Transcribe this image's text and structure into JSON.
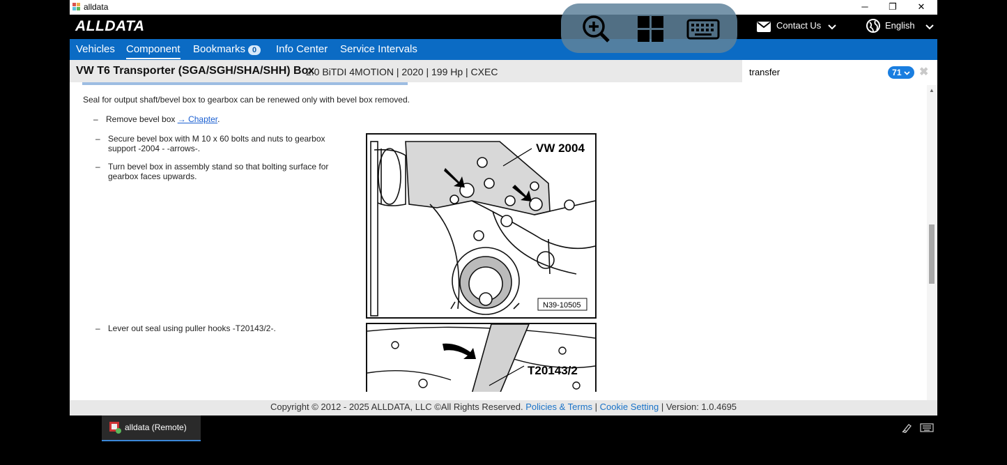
{
  "window": {
    "title": "alldata",
    "controls": [
      "─",
      "❐",
      "✕"
    ]
  },
  "header": {
    "logo": "ALLDATA",
    "contact_label": "Contact Us",
    "language_label": "English"
  },
  "nav": {
    "items": [
      {
        "label": "Vehicles"
      },
      {
        "label": "Component"
      },
      {
        "label": "Bookmarks"
      },
      {
        "label": "Info Center"
      },
      {
        "label": "Service Intervals"
      }
    ],
    "bookmarks_count": "0"
  },
  "vehicle": {
    "name": "VW T6 Transporter (SGA/SGH/SHA/SHH) Box",
    "specs": "2.0 BiTDI 4MOTION | 2020 | 199 Hp | CXEC"
  },
  "search": {
    "query": "transfer",
    "result_count": "71"
  },
  "content": {
    "intro": "Seal for output shaft/bevel box to gearbox can be renewed only with bevel box removed.",
    "steps": [
      {
        "text": "Remove bevel box ",
        "link": "→ Chapter",
        "suffix": "."
      },
      {
        "text": "Secure bevel box with M 10 x 60 bolts and nuts to gearbox support -2004 - -arrows-."
      },
      {
        "text": "Turn bevel box in assembly stand so that bolting surface for gearbox faces upwards."
      },
      {
        "text": "Lever out seal using puller hooks -T20143/2-."
      }
    ],
    "figure1": {
      "tool_label": "VW 2004",
      "ref": "N39-10505"
    },
    "figure2": {
      "tool_label": "T20143/2"
    }
  },
  "footer": {
    "copyright": "Copyright © 2012 - 2025 ALLDATA, LLC ©All Rights Reserved.",
    "policies": "Policies & Terms",
    "sep1": " | ",
    "cookie": "Cookie Setting",
    "version": " | Version: 1.0.4695"
  },
  "taskbar": {
    "task_label": "alldata (Remote)"
  },
  "colors": {
    "nav_blue": "#0b6bc4",
    "header_black": "#000000",
    "badge_blue": "#1a7ee0",
    "link_blue": "#1a73c8"
  }
}
